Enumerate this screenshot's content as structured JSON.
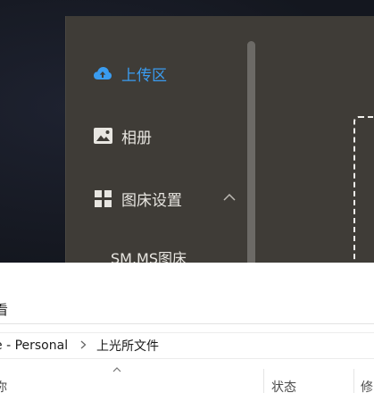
{
  "app": {
    "nav": {
      "upload_label": "上传区",
      "album_label": "相册",
      "settings_label": "图床设置",
      "submenu_item": "SM.MS图床"
    },
    "icons": {
      "upload": "cloud-upload-icon",
      "album": "image-icon",
      "settings": "grid-icon",
      "chevron": "chevron-up-icon"
    },
    "colors": {
      "active": "#3a9cf0",
      "sidebar_bg": "#3f3c37"
    }
  },
  "explorer": {
    "title_fragment": "看",
    "breadcrumb": {
      "parent": "e - Personal",
      "current": "上光所文件"
    },
    "columns": {
      "name": "你",
      "status": "状态",
      "modified": "修"
    }
  }
}
